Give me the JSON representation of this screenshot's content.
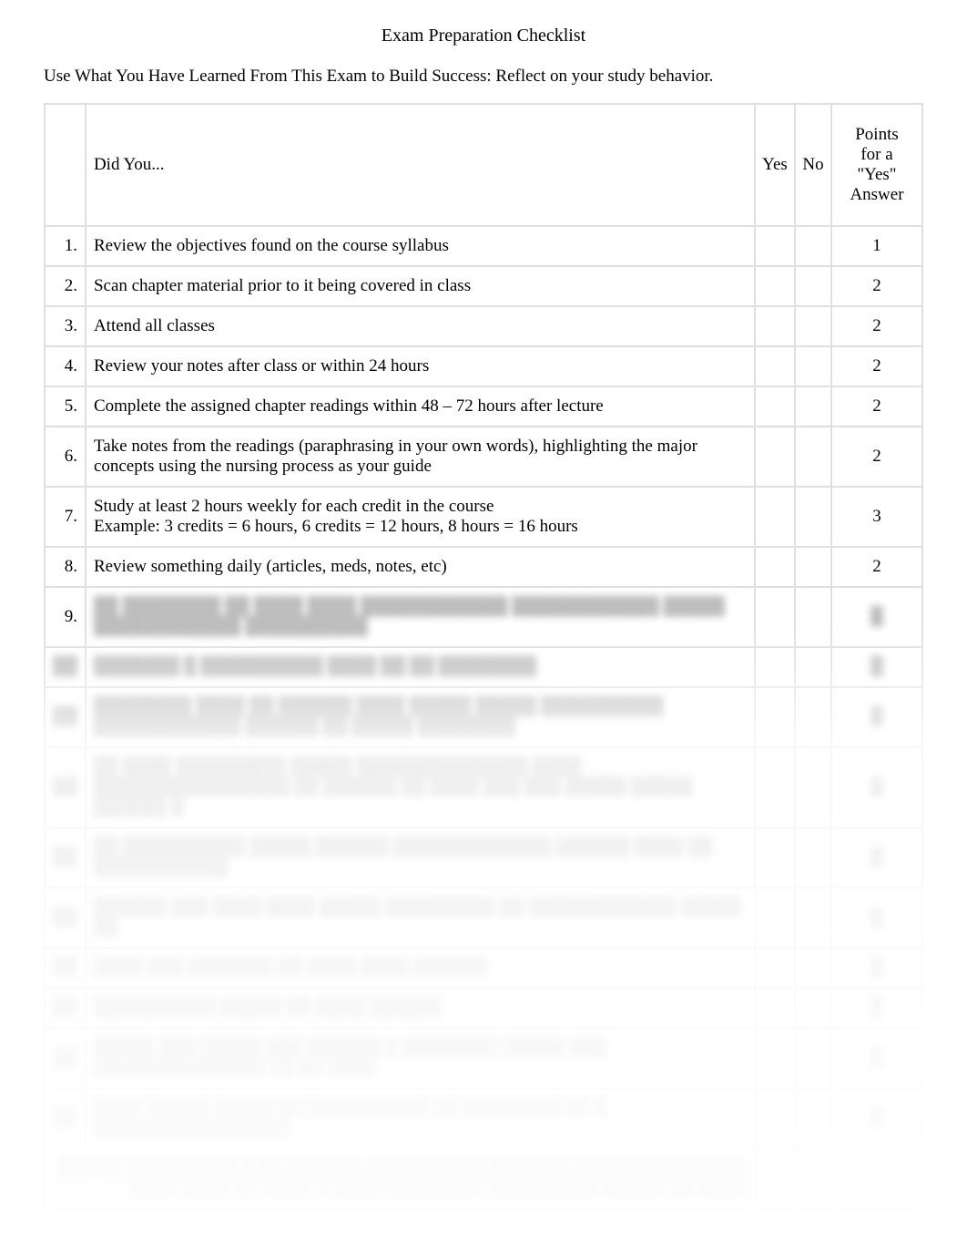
{
  "title": "Exam Preparation Checklist",
  "subtitle": "Use What You Have Learned From This Exam to Build Success: Reflect on your study behavior.",
  "headers": {
    "question": "Did You...",
    "yes": "Yes",
    "no": "No",
    "points": "Points for a \"Yes\" Answer"
  },
  "rows": [
    {
      "num": "1.",
      "text": "Review the objectives found on the course syllabus",
      "points": "1"
    },
    {
      "num": "2.",
      "text": "Scan chapter material prior to it being covered in class",
      "points": "2"
    },
    {
      "num": "3.",
      "text": "Attend all classes",
      "points": "2"
    },
    {
      "num": "4.",
      "text": "Review your notes after class or within 24 hours",
      "points": "2"
    },
    {
      "num": "5.",
      "text": "Complete the assigned chapter readings within 48 – 72 hours after lecture",
      "points": "2"
    },
    {
      "num": "6.",
      "text": "Take notes from the readings (paraphrasing in your own words), highlighting the major concepts using the nursing process as your guide",
      "points": "2"
    },
    {
      "num": "7.",
      "text": "Study at least 2 hours weekly for each credit in the course",
      "example": "Example: 3 credits = 6 hours, 6 credits = 12 hours, 8 hours = 16 hours",
      "points": "3"
    },
    {
      "num": "8.",
      "text": "Review something daily (articles, meds, notes, etc)",
      "points": "2"
    },
    {
      "num": "9.",
      "text": "",
      "points": ""
    }
  ]
}
